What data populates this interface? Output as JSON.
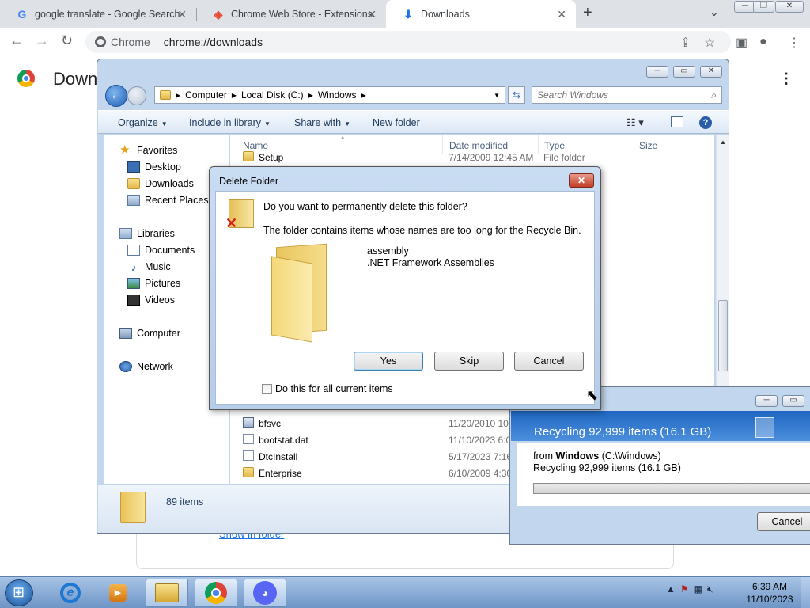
{
  "chrome": {
    "tabs": [
      {
        "title": "google translate - Google Search",
        "icon": "google-icon",
        "active": false
      },
      {
        "title": "Chrome Web Store - Extensions",
        "icon": "web-store-icon",
        "active": false
      },
      {
        "title": "Downloads",
        "icon": "download-icon",
        "active": true
      }
    ],
    "omnibox": {
      "site_label": "Chrome",
      "url": "chrome://downloads"
    },
    "page": {
      "title": "Down",
      "show_in_folder": "Show in folder"
    }
  },
  "explorer": {
    "address": [
      "Computer",
      "Local Disk (C:)",
      "Windows"
    ],
    "search_placeholder": "Search Windows",
    "commands": {
      "organize": "Organize",
      "include": "Include in library",
      "share": "Share with",
      "new_folder": "New folder"
    },
    "nav": {
      "favorites": "Favorites",
      "desktop": "Desktop",
      "downloads": "Downloads",
      "recent": "Recent Places",
      "libraries": "Libraries",
      "documents": "Documents",
      "music": "Music",
      "pictures": "Pictures",
      "videos": "Videos",
      "computer": "Computer",
      "network": "Network"
    },
    "columns": {
      "name": "Name",
      "date": "Date modified",
      "type": "Type",
      "size": "Size"
    },
    "files": [
      {
        "name": "Setup",
        "date": "7/14/2009 12:45 AM",
        "type": "File folder"
      },
      {
        "name": "bfsvc",
        "date": "11/20/2010 10:",
        "type": ""
      },
      {
        "name": "bootstat.dat",
        "date": "11/10/2023 6:0",
        "type": ""
      },
      {
        "name": "DtcInstall",
        "date": "5/17/2023 7:16",
        "type": ""
      },
      {
        "name": "Enterprise",
        "date": "6/10/2009 4:30",
        "type": ""
      }
    ],
    "details": {
      "count": "89 items"
    }
  },
  "delete_dialog": {
    "title": "Delete Folder",
    "question": "Do you want to permanently delete this folder?",
    "reason": "The folder contains items whose names are too long for the Recycle Bin.",
    "item_name": "assembly",
    "item_desc": ".NET Framework Assemblies",
    "yes": "Yes",
    "skip": "Skip",
    "cancel": "Cancel",
    "do_all": "Do this for all current items"
  },
  "recycle": {
    "title": "Recycling 92,999 items (16.1 GB)",
    "from_prefix": "from ",
    "from_name": "Windows",
    "from_path": " (C:\\Windows)",
    "items": "Recycling 92,999 items (16.1 GB)",
    "progress": 0.0,
    "cancel": "Cancel"
  },
  "taskbar": {
    "time": "6:39 AM",
    "date": "11/10/2023"
  }
}
